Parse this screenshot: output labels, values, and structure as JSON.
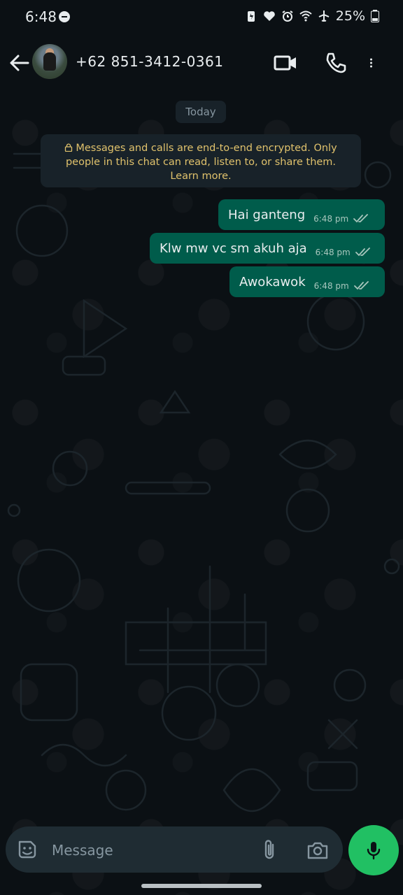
{
  "status_bar": {
    "time": "6:48",
    "battery": "25%",
    "icons": [
      "dnd-icon",
      "battery-saver-icon",
      "heart-icon",
      "alarm-icon",
      "wifi-icon",
      "airplane-icon",
      "battery-icon"
    ]
  },
  "header": {
    "contact_name": "+62 851-3412-0361",
    "icons": [
      "back-arrow-icon",
      "avatar",
      "video-call-icon",
      "phone-icon",
      "more-vert-icon"
    ]
  },
  "chat": {
    "date_chip": "Today",
    "encryption_notice": "Messages and calls are end-to-end encrypted. Only people in this chat can read, listen to, or share them. Learn more.",
    "messages": [
      {
        "text": "Hai ganteng",
        "time": "6:48 pm",
        "status": "read"
      },
      {
        "text": "Klw mw vc sm akuh aja",
        "time": "6:48 pm",
        "status": "read"
      },
      {
        "text": "Awokawok",
        "time": "6:48 pm",
        "status": "read"
      }
    ]
  },
  "composer": {
    "placeholder": "Message",
    "value": "",
    "icons": [
      "sticker-icon",
      "attach-icon",
      "camera-icon",
      "mic-icon"
    ]
  },
  "colors": {
    "background": "#0b1014",
    "outgoing_bubble": "#005c4b",
    "notice_text": "#e0c26c",
    "mic_button": "#21c063"
  }
}
